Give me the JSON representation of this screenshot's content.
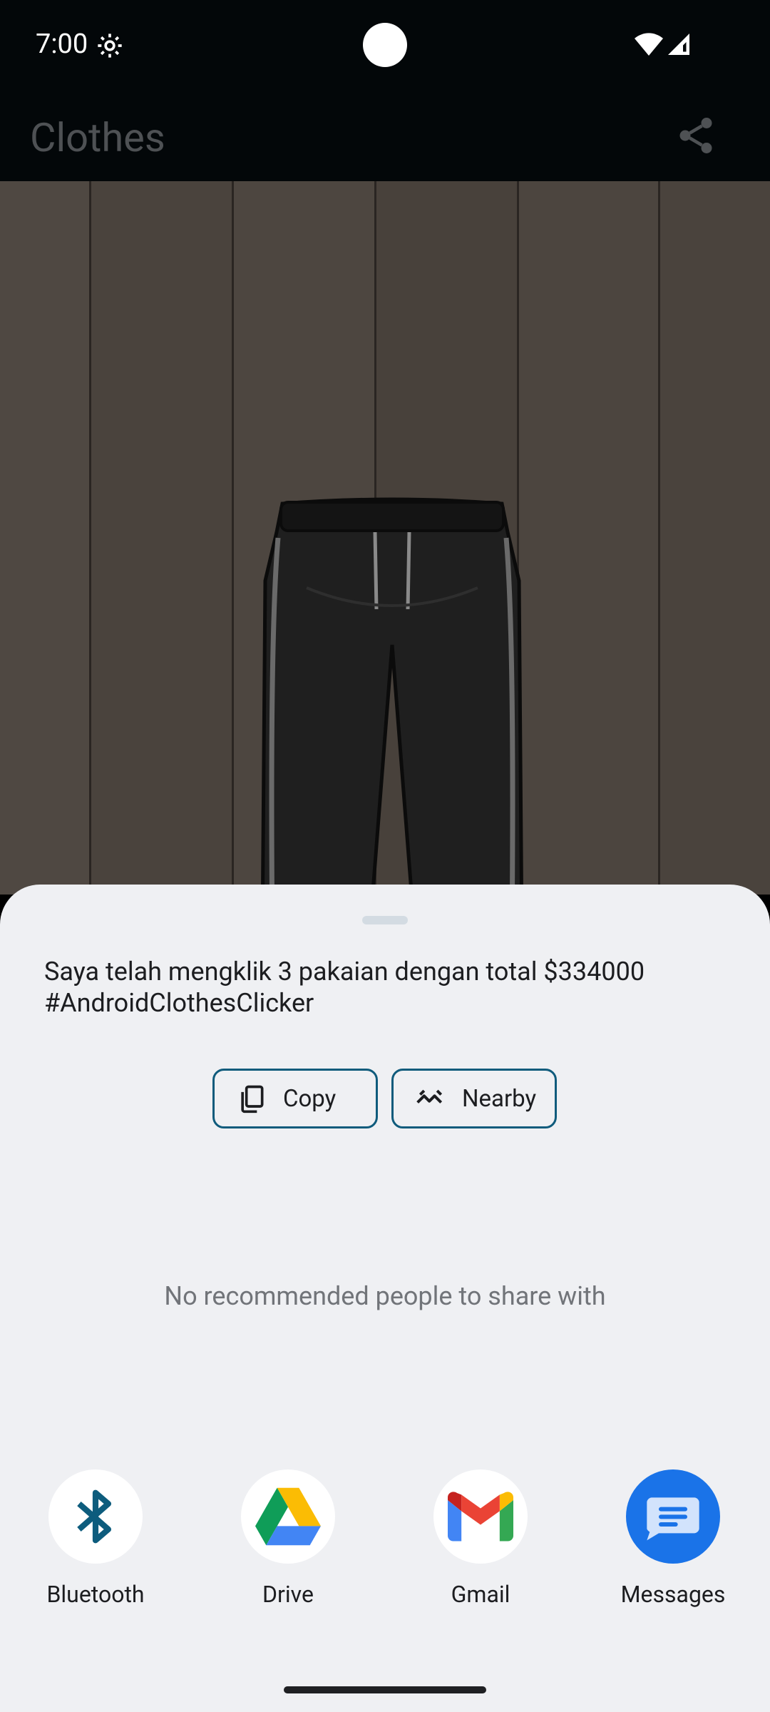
{
  "status_bar": {
    "time": "7:00"
  },
  "app_bar": {
    "title": "Clothes"
  },
  "share_sheet": {
    "text": "Saya telah mengklik 3 pakaian dengan total $334000 #AndroidClothesClicker",
    "actions": [
      {
        "label": "Copy",
        "icon": "copy-icon"
      },
      {
        "label": "Nearby",
        "icon": "nearby-icon"
      }
    ],
    "empty_message": "No recommended people to share with",
    "apps": [
      {
        "label": "Bluetooth",
        "icon": "bluetooth-icon"
      },
      {
        "label": "Drive",
        "icon": "drive-icon"
      },
      {
        "label": "Gmail",
        "icon": "gmail-icon"
      },
      {
        "label": "Messages",
        "icon": "messages-icon"
      }
    ]
  },
  "colors": {
    "sheet_bg": "#eff0f3",
    "chip_border": "#0f5b7c",
    "messages_blue": "#1a73e8"
  }
}
